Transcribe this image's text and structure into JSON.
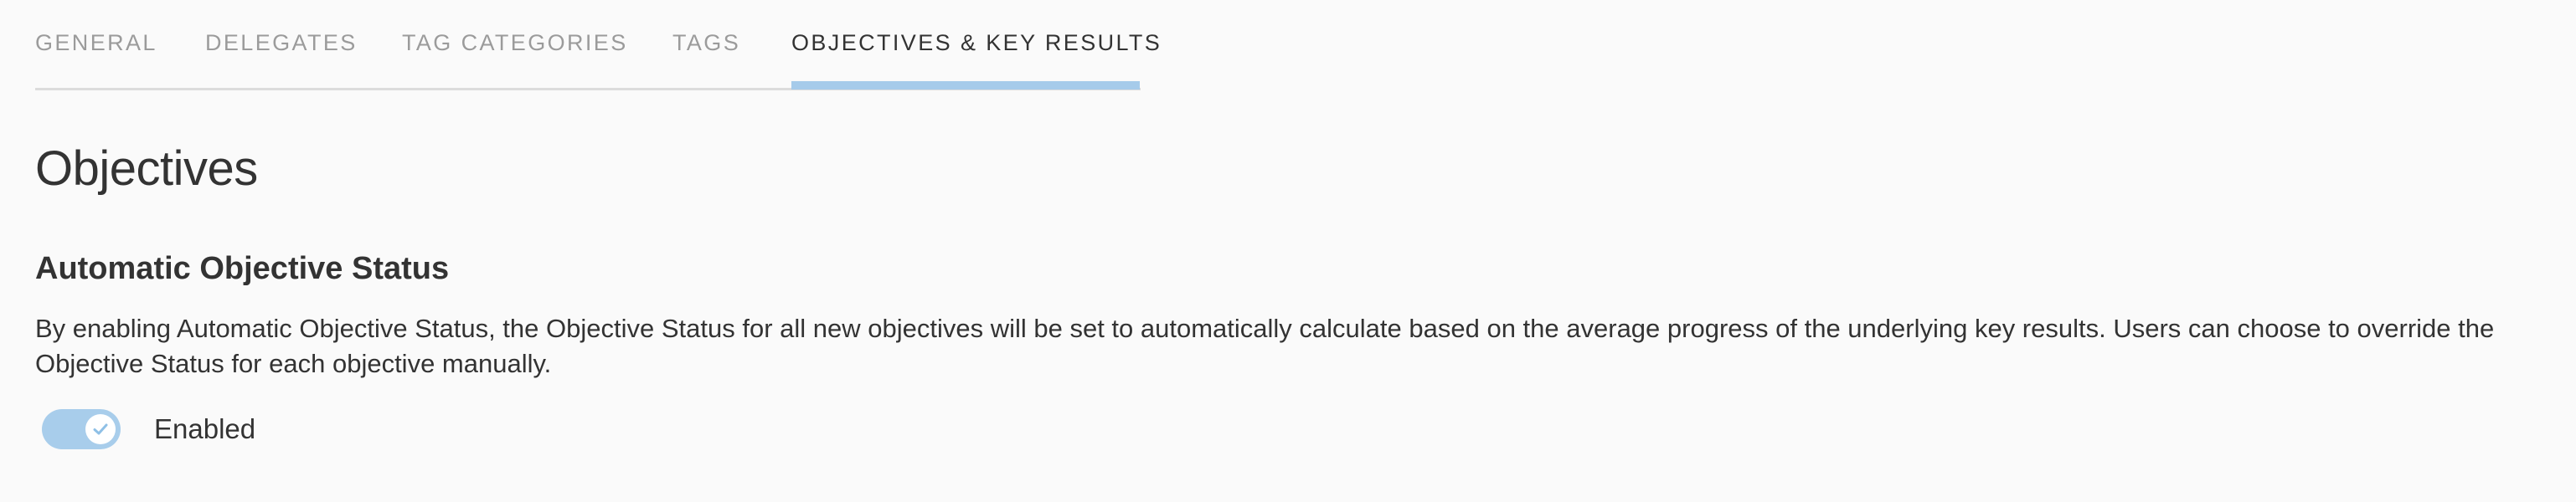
{
  "tabs": [
    {
      "label": "GENERAL"
    },
    {
      "label": "DELEGATES"
    },
    {
      "label": "TAG CATEGORIES"
    },
    {
      "label": "TAGS"
    },
    {
      "label": "OBJECTIVES & KEY RESULTS",
      "active": true
    }
  ],
  "page": {
    "title": "Objectives"
  },
  "section": {
    "title": "Automatic Objective Status",
    "description": "By enabling Automatic Objective Status, the Objective Status for all new objectives will be set to automatically calculate based on the average progress of the underlying key results. Users can choose to override the Objective Status for each objective manually."
  },
  "toggle": {
    "label": "Enabled",
    "state": "on",
    "icon": "check-icon"
  },
  "colors": {
    "accent": "#a6cbea",
    "tab_inactive": "#9b9b9b",
    "text": "#333333",
    "background": "#fafafa"
  }
}
